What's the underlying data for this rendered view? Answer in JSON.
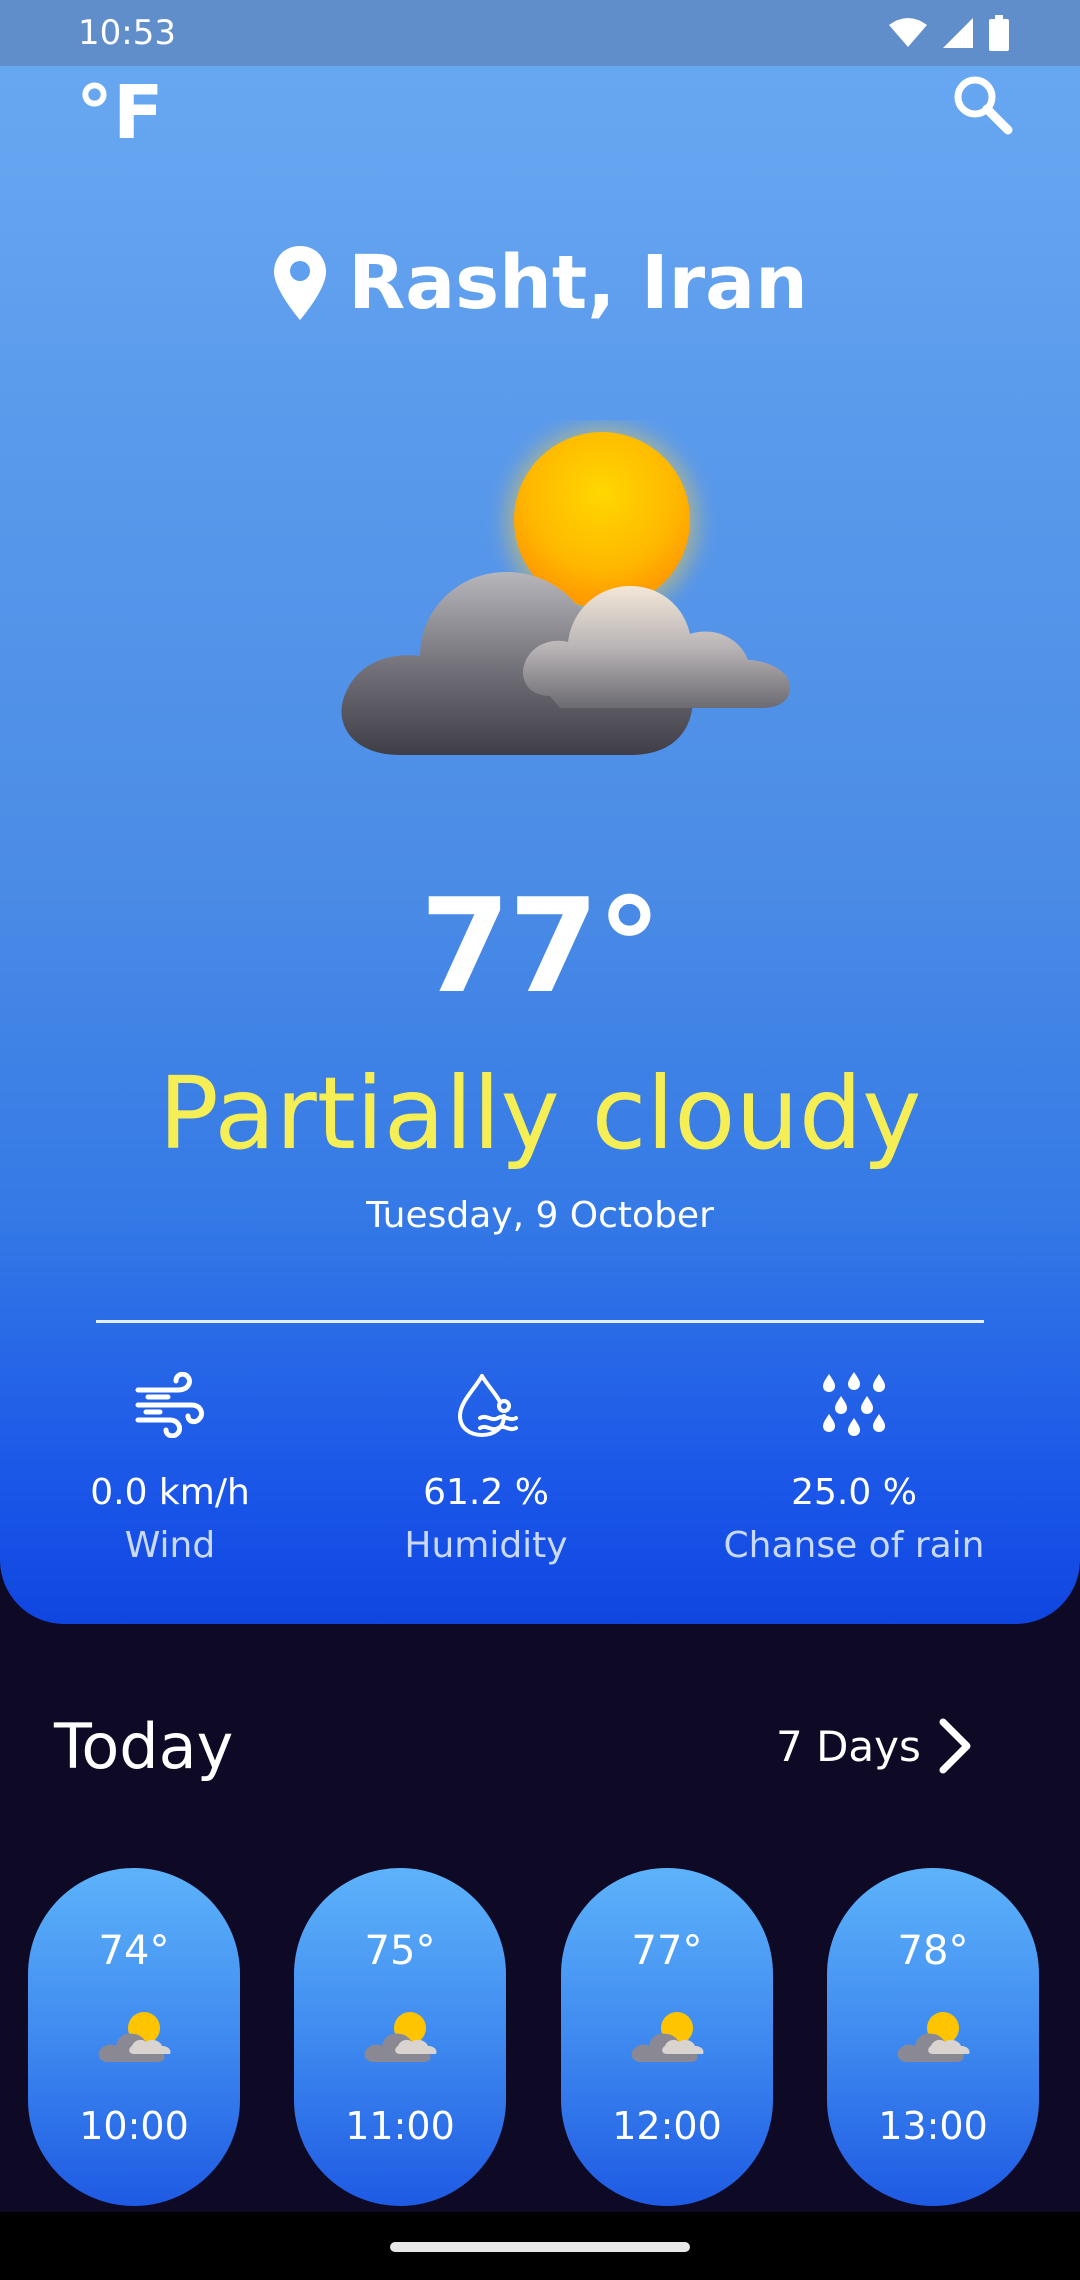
{
  "status_bar": {
    "time": "10:53",
    "icons": [
      "wifi-icon",
      "signal-icon",
      "battery-icon"
    ]
  },
  "header": {
    "unit_toggle": "°F",
    "search_icon": "search-icon"
  },
  "location": {
    "icon": "location-pin-icon",
    "name": "Rasht, Iran"
  },
  "current": {
    "icon": "partly-cloudy-icon",
    "temperature": "77°",
    "condition": "Partially cloudy",
    "date": "Tuesday, 9 October"
  },
  "metrics": [
    {
      "icon": "wind-icon",
      "value": "0.0 km/h",
      "label": "Wind"
    },
    {
      "icon": "humidity-icon",
      "value": "61.2 %",
      "label": "Humidity"
    },
    {
      "icon": "rain-drops-icon",
      "value": "25.0 %",
      "label": "Chanse of rain"
    }
  ],
  "today": {
    "title": "Today",
    "more_label": "7 Days",
    "more_icon": "chevron-right-icon",
    "hours": [
      {
        "temp": "74°",
        "time": "10:00",
        "icon": "partly-cloudy-icon"
      },
      {
        "temp": "75°",
        "time": "11:00",
        "icon": "partly-cloudy-icon"
      },
      {
        "temp": "77°",
        "time": "12:00",
        "icon": "partly-cloudy-icon"
      },
      {
        "temp": "78°",
        "time": "13:00",
        "icon": "partly-cloudy-icon"
      }
    ]
  },
  "colors": {
    "condition_text": "#f6ee55",
    "background": "#0e0a26",
    "card_top": "#6aaaf2",
    "card_bottom": "#0f46e0"
  }
}
